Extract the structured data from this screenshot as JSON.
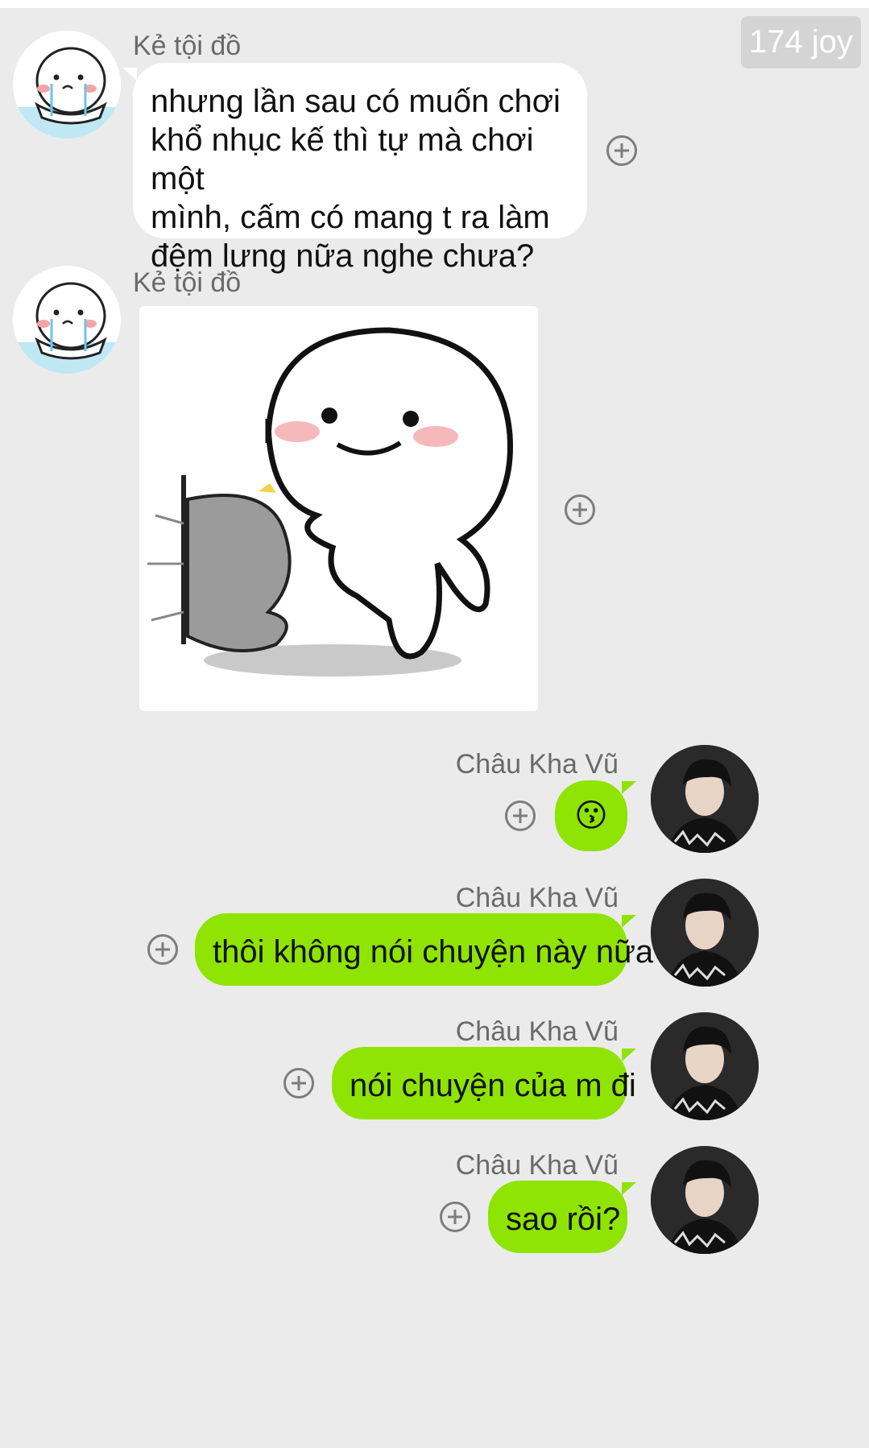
{
  "watermark": "174 joy",
  "contacts": {
    "other": "Kẻ tội đồ",
    "me": "Châu Kha Vũ"
  },
  "messages": [
    {
      "sender": "Kẻ tội đồ",
      "text": "nhưng lần sau có muốn chơi khổ nhục kế thì tự mà chơi một mình, cấm có mang t ra làm đệm lưng nữa nghe chưa?",
      "lines": [
        "nhưng lần sau có muốn chơi",
        "khổ nhục kế thì tự mà chơi một",
        "mình, cấm có mang t ra làm",
        "đệm lưng nữa nghe chưa?"
      ]
    },
    {
      "sender": "Kẻ tội đồ",
      "type": "sticker",
      "sticker_icon": "blob-kicking-sticker"
    },
    {
      "sender": "Châu Kha Vũ",
      "text": "😗"
    },
    {
      "sender": "Châu Kha Vũ",
      "text": "thôi không nói chuyện này nữa"
    },
    {
      "sender": "Châu Kha Vũ",
      "text": "nói chuyện của m đi"
    },
    {
      "sender": "Châu Kha Vũ",
      "text": "sao rồi?"
    }
  ],
  "colors": {
    "background": "#ebebeb",
    "incoming_bubble": "#ffffff",
    "outgoing_bubble": "#8fe404",
    "name_text": "#6a6a6a"
  }
}
